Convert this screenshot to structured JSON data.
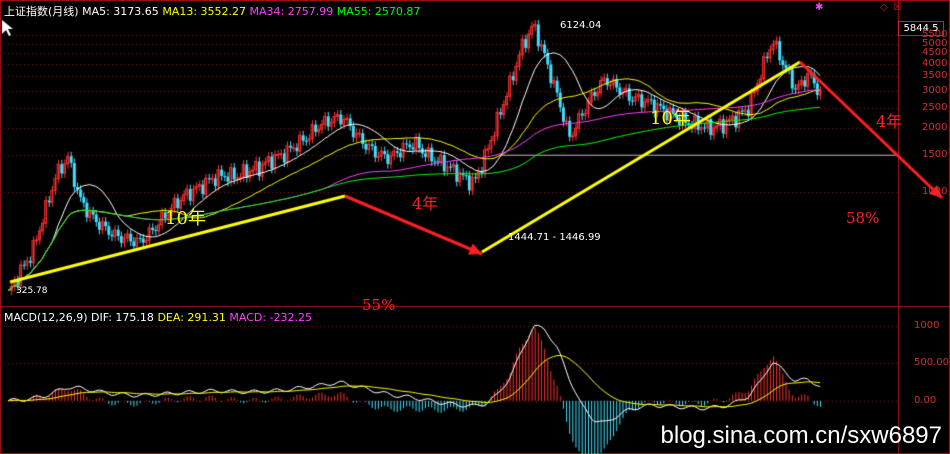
{
  "colors": {
    "up": "#ff3030",
    "down": "#40e0ff",
    "ma5": "#ffffff",
    "ma13": "#ffff00",
    "ma34": "#ff40ff",
    "ma55": "#00ff00",
    "axis": "#b01010",
    "text_red": "#ff2020",
    "dif": "#ffffff",
    "dea": "#ffff00",
    "macd": "#ff40ff"
  },
  "header": {
    "title": "上证指数(月线)",
    "ma5": "MA5: 3173.65",
    "ma13": "MA13: 3552.27",
    "ma34": "MA34: 2757.99",
    "ma55": "MA55: 2570.87"
  },
  "macd_header": {
    "label": "MACD(12,26,9)",
    "dif": "DIF: 175.18",
    "dea": "DEA: 291.31",
    "macd": "MACD: -232.25"
  },
  "price_axis": {
    "labels": [
      "5500",
      "5000",
      "4500",
      "4000",
      "3500",
      "3000",
      "2500",
      "2000",
      "1500",
      "1000"
    ],
    "current": "5844.5",
    "scale": "log"
  },
  "macd_axis": {
    "labels": [
      "1000",
      "500.00",
      "0.00"
    ]
  },
  "annotations": {
    "high_label": "6124.04",
    "low_label": "1444.71 - 1446.99",
    "start_label": "325.78",
    "first_trend": "10年",
    "first_drop": "4年",
    "first_drop_pct": "55%",
    "second_trend": "10年",
    "second_drop": "4年",
    "second_drop_pct": "58%"
  },
  "watermark": "blog.sina.com.cn/sxw6897",
  "chart_data": {
    "type": "candlestick",
    "title": "上证指数(月线)",
    "ylim": [
      300,
      6600
    ],
    "series": [
      {
        "name": "上证指数",
        "values": [
          330,
          420,
          520,
          780,
          1200,
          1450,
          920,
          760,
          680,
          620,
          600,
          580,
          650,
          760,
          880,
          980,
          1050,
          1150,
          1200,
          1180,
          1250,
          1300,
          1420,
          1500,
          1650,
          1800,
          2050,
          2180,
          2245,
          1900,
          1650,
          1500,
          1450,
          1600,
          1700,
          1500,
          1400,
          1300,
          1180,
          1100,
          1500,
          2200,
          3200,
          4800,
          6124,
          4200,
          2800,
          1800,
          2300,
          2900,
          3400,
          3100,
          2800,
          2700,
          2600,
          2400,
          2250,
          2100,
          2050,
          2000,
          2100,
          2250,
          2500,
          3600,
          5178,
          3900,
          3000,
          3600,
          2900
        ]
      }
    ],
    "notable": {
      "start": 325.78,
      "peak": 6124.04,
      "trough": "1444.71 - 1446.99"
    },
    "ma_values": {
      "MA5": 3173.65,
      "MA13": 3552.27,
      "MA34": 2757.99,
      "MA55": 2570.87
    },
    "macd": {
      "params": "MACD(12,26,9)",
      "DIF": 175.18,
      "DEA": 291.31,
      "MACD": -232.25,
      "ylim": [
        -550,
        1050
      ],
      "dif_path": [
        0,
        10,
        30,
        60,
        120,
        180,
        170,
        140,
        110,
        90,
        80,
        70,
        80,
        90,
        100,
        110,
        120,
        130,
        130,
        120,
        120,
        120,
        130,
        140,
        160,
        180,
        200,
        230,
        240,
        200,
        160,
        120,
        80,
        60,
        40,
        10,
        -20,
        -40,
        -60,
        -70,
        -40,
        80,
        300,
        650,
        1000,
        950,
        700,
        300,
        -50,
        -250,
        -300,
        -200,
        -120,
        -80,
        -60,
        -70,
        -80,
        -90,
        -100,
        -90,
        -70,
        -20,
        60,
        250,
        520,
        400,
        250,
        300,
        175
      ]
    }
  }
}
